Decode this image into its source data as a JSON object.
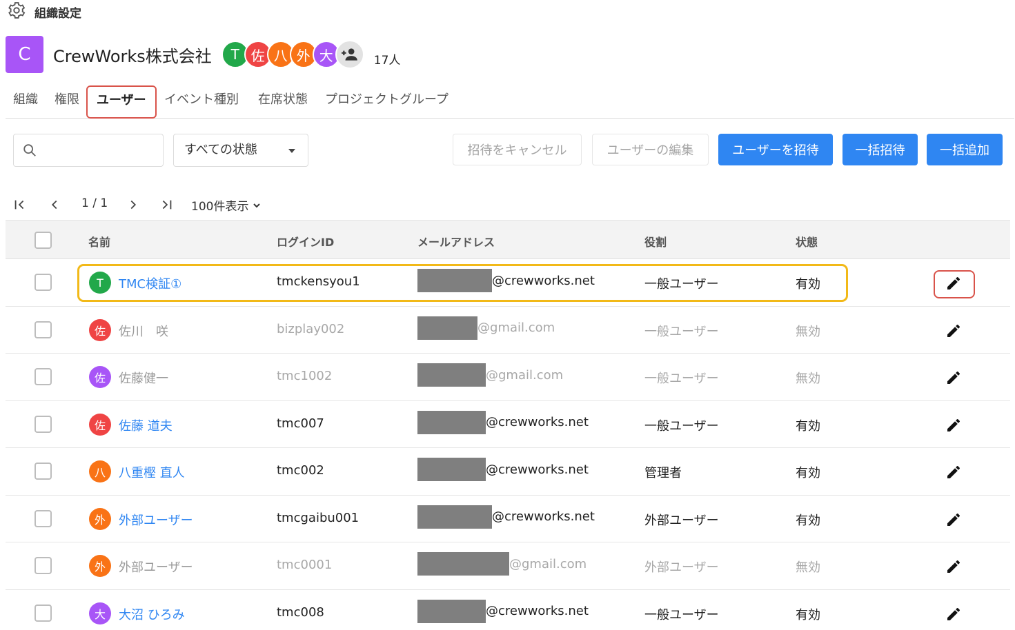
{
  "header": {
    "title": "組織設定",
    "icon": "gear-icon"
  },
  "org": {
    "logo_letter": "C",
    "logo_color": "#a855f7",
    "name": "CrewWorks株式会社",
    "member_count": "17人",
    "avatars": [
      {
        "letter": "T",
        "color": "#22a84a"
      },
      {
        "letter": "佐",
        "color": "#ef4444"
      },
      {
        "letter": "八",
        "color": "#f97316"
      },
      {
        "letter": "外",
        "color": "#f97316"
      },
      {
        "letter": "大",
        "color": "#a855f7"
      }
    ],
    "add_member_icon": "person-add-icon"
  },
  "tabs": [
    {
      "label": "組織",
      "active": false
    },
    {
      "label": "権限",
      "active": false
    },
    {
      "label": "ユーザー",
      "active": true
    },
    {
      "label": "イベント種別",
      "active": false
    },
    {
      "label": "在席状態",
      "active": false
    },
    {
      "label": "プロジェクトグループ",
      "active": false
    }
  ],
  "toolbar": {
    "search_placeholder": "",
    "search_icon": "search-icon",
    "status_filter": "すべての状態",
    "cancel_invite": "招待をキャンセル",
    "edit_users": "ユーザーの編集",
    "invite_user": "ユーザーを招待",
    "bulk_invite": "一括招待",
    "bulk_add": "一括追加"
  },
  "pagination": {
    "page": "1 / 1",
    "per_page": "100件表示"
  },
  "table": {
    "columns": {
      "name": "名前",
      "login": "ログインID",
      "email": "メールアドレス",
      "role": "役割",
      "status": "状態"
    },
    "rows": [
      {
        "avatar": "T",
        "avatar_color": "#22a84a",
        "name": "TMC検証①",
        "login": "tmckensyou1",
        "email_domain": "@crewworks.net",
        "role": "一般ユーザー",
        "status": "有効",
        "active": true
      },
      {
        "avatar": "佐",
        "avatar_color": "#ef4444",
        "name": "佐川　咲",
        "login": "bizplay002",
        "email_domain": "@gmail.com",
        "role": "一般ユーザー",
        "status": "無効",
        "active": false
      },
      {
        "avatar": "佐",
        "avatar_color": "#a855f7",
        "name": "佐藤健一",
        "login": "tmc1002",
        "email_domain": "@gmail.com",
        "role": "一般ユーザー",
        "status": "無効",
        "active": false
      },
      {
        "avatar": "佐",
        "avatar_color": "#ef4444",
        "name": "佐藤 道夫",
        "login": "tmc007",
        "email_domain": "@crewworks.net",
        "role": "一般ユーザー",
        "status": "有効",
        "active": true
      },
      {
        "avatar": "八",
        "avatar_color": "#f97316",
        "name": "八重樫 直人",
        "login": "tmc002",
        "email_domain": "@crewworks.net",
        "role": "管理者",
        "status": "有効",
        "active": true
      },
      {
        "avatar": "外",
        "avatar_color": "#f97316",
        "name": "外部ユーザー",
        "login": "tmcgaibu001",
        "email_domain": "@crewworks.net",
        "role": "外部ユーザー",
        "status": "有効",
        "active": true
      },
      {
        "avatar": "外",
        "avatar_color": "#f97316",
        "name": "外部ユーザー",
        "login": "tmc0001",
        "email_domain": "@gmail.com",
        "role": "外部ユーザー",
        "status": "無効",
        "active": false
      },
      {
        "avatar": "大",
        "avatar_color": "#a855f7",
        "name": "大沼 ひろみ",
        "login": "tmc008",
        "email_domain": "@crewworks.net",
        "role": "一般ユーザー",
        "status": "有効",
        "active": true
      }
    ]
  }
}
